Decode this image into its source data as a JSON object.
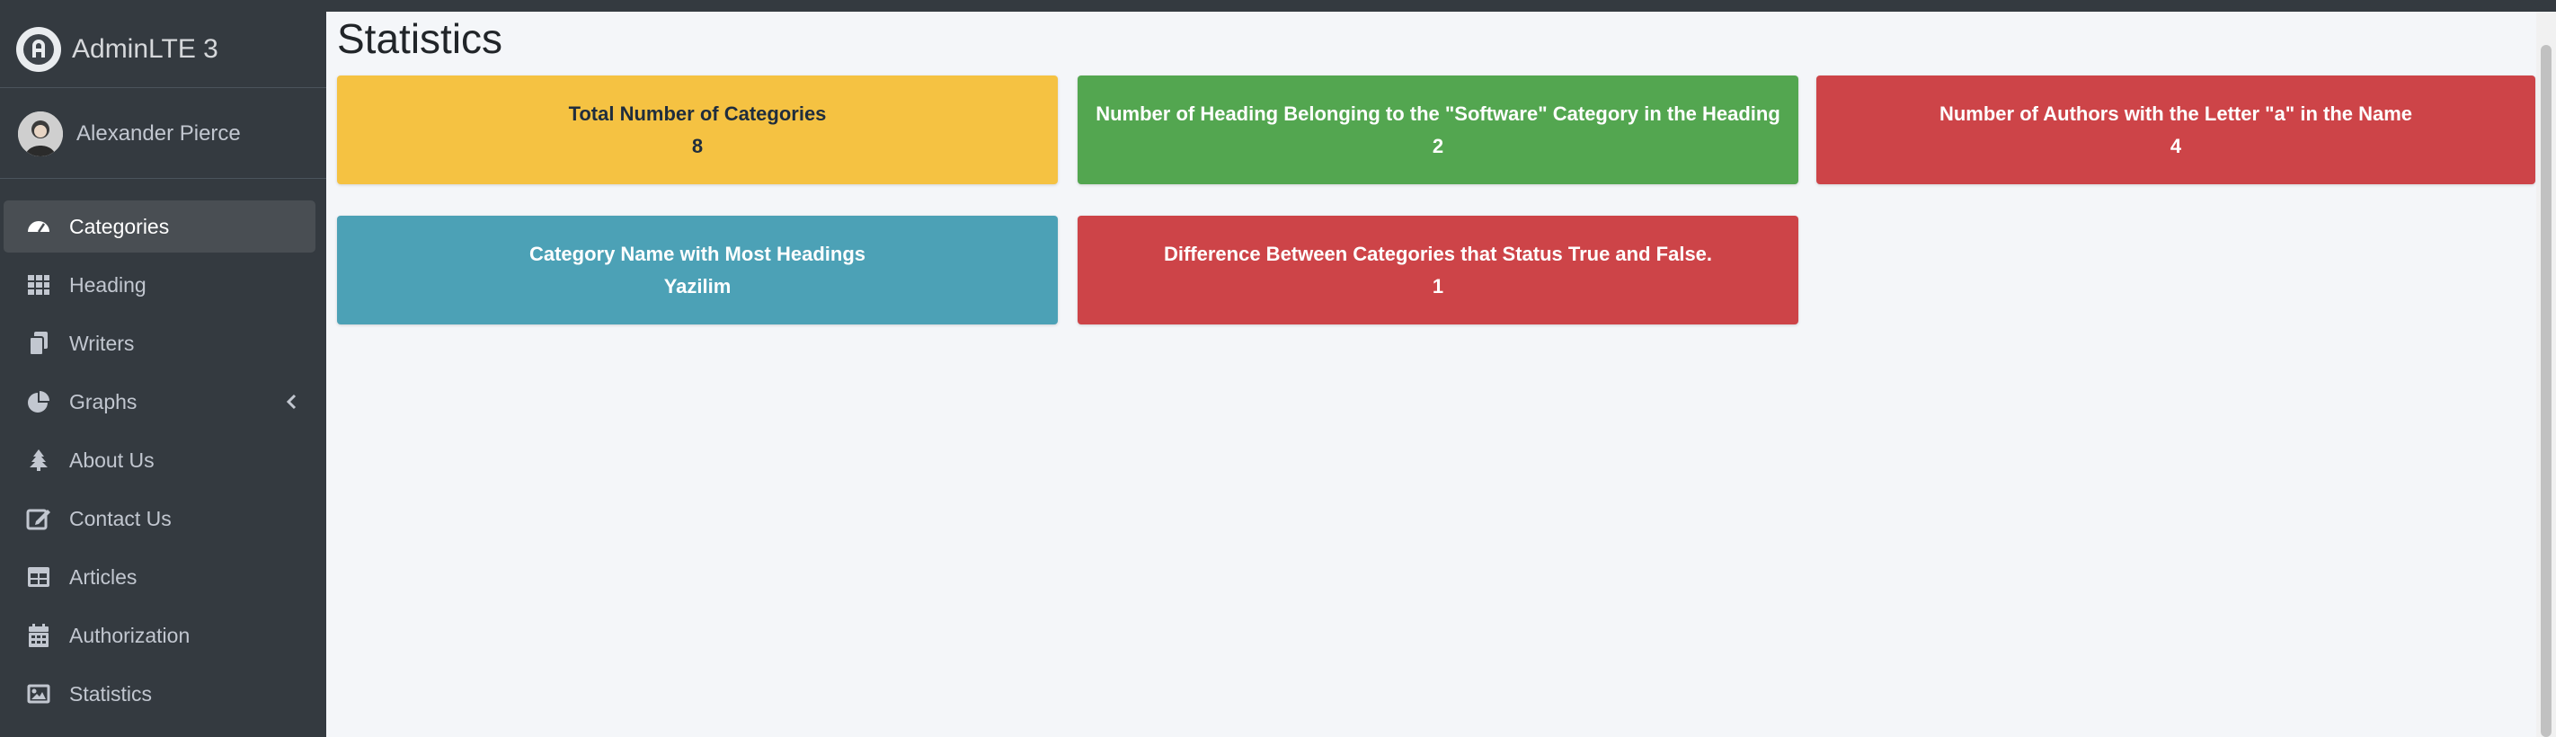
{
  "brand": {
    "name": "AdminLTE 3",
    "logo_icon": "adminlte-logo-icon"
  },
  "user": {
    "name": "Alexander Pierce",
    "avatar_icon": "user-avatar-icon"
  },
  "sidebar": {
    "items": [
      {
        "label": "Categories",
        "icon": "dashboard-gauge-icon",
        "active": true
      },
      {
        "label": "Heading",
        "icon": "grid-icon"
      },
      {
        "label": "Writers",
        "icon": "copy-files-icon"
      },
      {
        "label": "Graphs",
        "icon": "pie-chart-icon",
        "has_submenu": true
      },
      {
        "label": "About Us",
        "icon": "tree-icon"
      },
      {
        "label": "Contact Us",
        "icon": "edit-icon"
      },
      {
        "label": "Articles",
        "icon": "table-icon"
      },
      {
        "label": "Authorization",
        "icon": "calendar-icon"
      },
      {
        "label": "Statistics",
        "icon": "image-icon"
      }
    ]
  },
  "page": {
    "title": "Statistics"
  },
  "stats": [
    {
      "title": "Total Number of Categories",
      "value": "8",
      "color": "#f5c242"
    },
    {
      "title": "Number of Heading Belonging to the \"Software\" Category in the Heading",
      "value": "2",
      "color": "#53a650"
    },
    {
      "title": "Number of Authors with the Letter \"a\" in the Name",
      "value": "4",
      "color": "#cd4448"
    },
    {
      "title": "Category Name with Most Headings",
      "value": "Yazilim",
      "color": "#4ca1b6"
    },
    {
      "title": "Difference Between Categories that Status True and False.",
      "value": "1",
      "color": "#cd4448"
    }
  ],
  "colors": {
    "sidebar_bg": "#343a40",
    "content_bg": "#f4f6f9",
    "active_item_bg": "#494e53"
  }
}
